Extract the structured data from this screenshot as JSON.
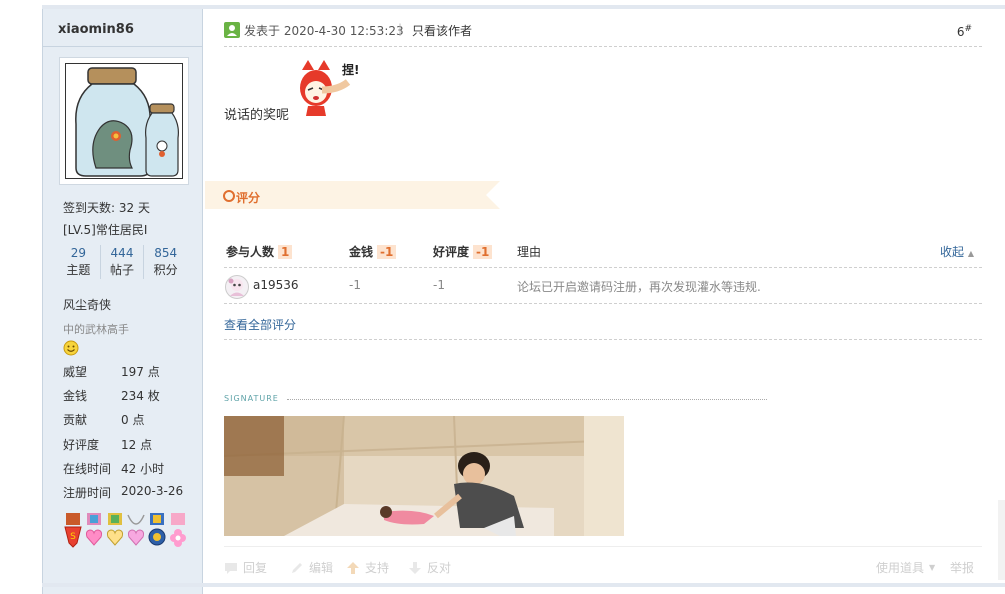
{
  "sidebar": {
    "username": "xiaomin86",
    "checkin": "签到天数: 32 天",
    "level": "[LV.5]常住居民I",
    "stats": [
      {
        "num": "29",
        "label": "主题"
      },
      {
        "num": "444",
        "label": "帖子"
      },
      {
        "num": "854",
        "label": "积分"
      }
    ],
    "group": "风尘奇侠",
    "group_sub": "中的武林高手",
    "profile": [
      {
        "k": "威望",
        "v": "197 点"
      },
      {
        "k": "金钱",
        "v": "234 枚"
      },
      {
        "k": "贡献",
        "v": "0 点"
      },
      {
        "k": "好评度",
        "v": "12 点"
      },
      {
        "k": "在线时间",
        "v": "42 小时"
      },
      {
        "k": "注册时间",
        "v": "2020-3-26"
      }
    ]
  },
  "post": {
    "time": "发表于 2020-4-30 12:53:23",
    "separator": "|",
    "only_author": "只看该作者",
    "floor": "6",
    "floor_mark": "#",
    "text": "说话的奖呢",
    "emoji_text": "捏!"
  },
  "rating": {
    "title": "评分",
    "headers": {
      "participants": "参与人数",
      "participants_count": "1",
      "money": "金钱",
      "money_total": "-1",
      "reputation": "好评度",
      "reputation_total": "-1",
      "reason": "理由",
      "collapse": "收起"
    },
    "rows": [
      {
        "user": "a19536",
        "money": "-1",
        "reputation": "-1",
        "reason": "论坛已开启邀请码注册，再次发现灌水等违规."
      }
    ],
    "view_all": "查看全部评分"
  },
  "signature": {
    "label": "SIGNATURE"
  },
  "actions": {
    "reply": "回复",
    "edit": "编辑",
    "support": "支持",
    "oppose": "反对",
    "use_tool": "使用道具",
    "report": "举报"
  }
}
